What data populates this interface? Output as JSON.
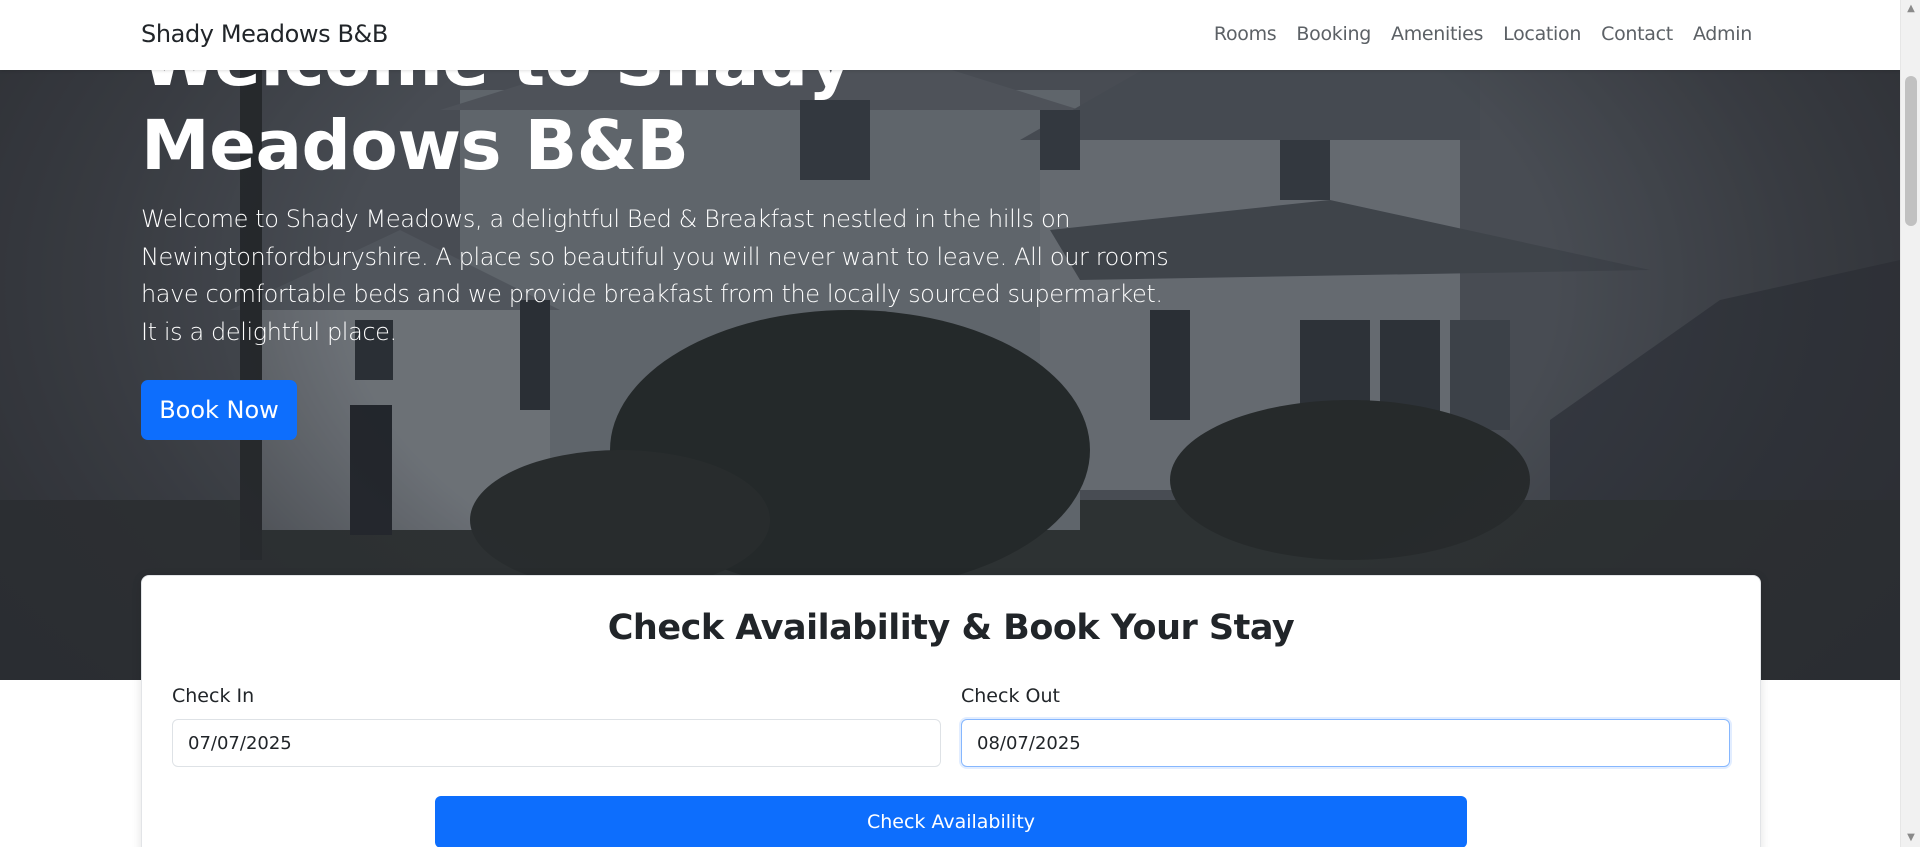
{
  "navbar": {
    "brand": "Shady Meadows B&B",
    "links": [
      "Rooms",
      "Booking",
      "Amenities",
      "Location",
      "Contact",
      "Admin"
    ]
  },
  "hero": {
    "title": "Welcome to Shady Meadows B&B",
    "description": "Welcome to Shady Meadows, a delightful Bed & Breakfast nestled in the hills on Newingtonfordburyshire. A place so beautiful you will never want to leave. All our rooms have comfortable beds and we provide breakfast from the locally sourced supermarket. It is a delightful place.",
    "book_now_label": "Book Now"
  },
  "booking": {
    "title": "Check Availability & Book Your Stay",
    "check_in_label": "Check In",
    "check_in_value": "07/07/2025",
    "check_out_label": "Check Out",
    "check_out_value": "08/07/2025",
    "submit_label": "Check Availability"
  },
  "colors": {
    "primary": "#0d6efd",
    "navbar_bg": "#ffffff"
  }
}
